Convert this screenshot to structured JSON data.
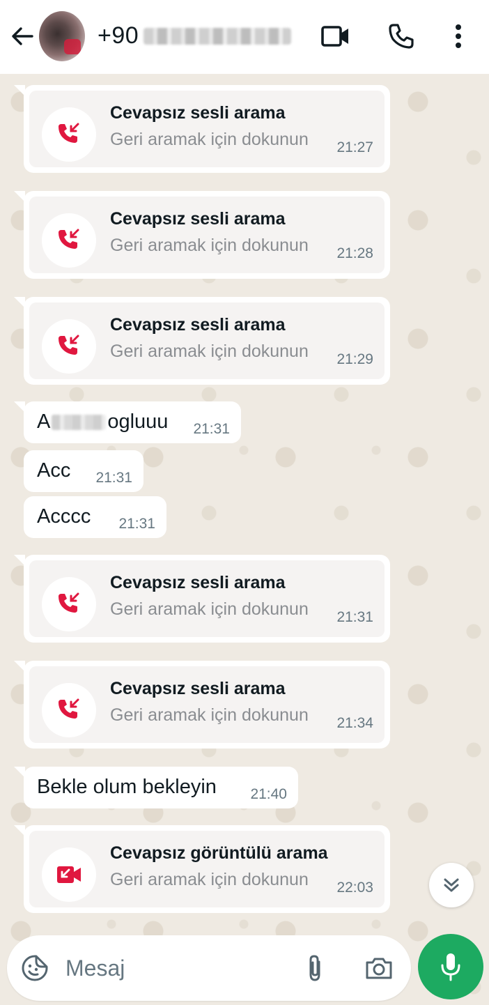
{
  "header": {
    "contact": "+90",
    "icons": [
      "back-arrow-icon",
      "video-call-icon",
      "voice-call-icon",
      "more-options-icon"
    ]
  },
  "messages": [
    {
      "type": "call",
      "title": "Cevapsız sesli arama",
      "subtitle": "Geri aramak için dokunun",
      "time": "21:27",
      "icon": "missed-voice-call-icon"
    },
    {
      "type": "call",
      "title": "Cevapsız sesli arama",
      "subtitle": "Geri aramak için dokunun",
      "time": "21:28",
      "icon": "missed-voice-call-icon"
    },
    {
      "type": "call",
      "title": "Cevapsız sesli arama",
      "subtitle": "Geri aramak için dokunun",
      "time": "21:29",
      "icon": "missed-voice-call-icon"
    },
    {
      "type": "text",
      "text_start": "A",
      "text_end": "ogluuu",
      "time": "21:31"
    },
    {
      "type": "text",
      "text": "Acc",
      "time": "21:31"
    },
    {
      "type": "text",
      "text": "Acccc",
      "time": "21:31"
    },
    {
      "type": "call",
      "title": "Cevapsız sesli arama",
      "subtitle": "Geri aramak için dokunun",
      "time": "21:31",
      "icon": "missed-voice-call-icon"
    },
    {
      "type": "call",
      "title": "Cevapsız sesli arama",
      "subtitle": "Geri aramak için dokunun",
      "time": "21:34",
      "icon": "missed-voice-call-icon"
    },
    {
      "type": "text",
      "text": "Bekle olum bekleyin",
      "time": "21:40"
    },
    {
      "type": "call",
      "title": "Cevapsız görüntülü arama",
      "subtitle": "Geri aramak için dokunun",
      "time": "22:03",
      "icon": "missed-video-call-icon"
    }
  ],
  "composer": {
    "placeholder": "Mesaj",
    "icons": [
      "sticker-icon",
      "attach-icon",
      "camera-icon",
      "mic-icon"
    ]
  },
  "colors": {
    "missed_call": "#e0173f",
    "send_button": "#1daa61",
    "chat_background": "#efeae2"
  }
}
